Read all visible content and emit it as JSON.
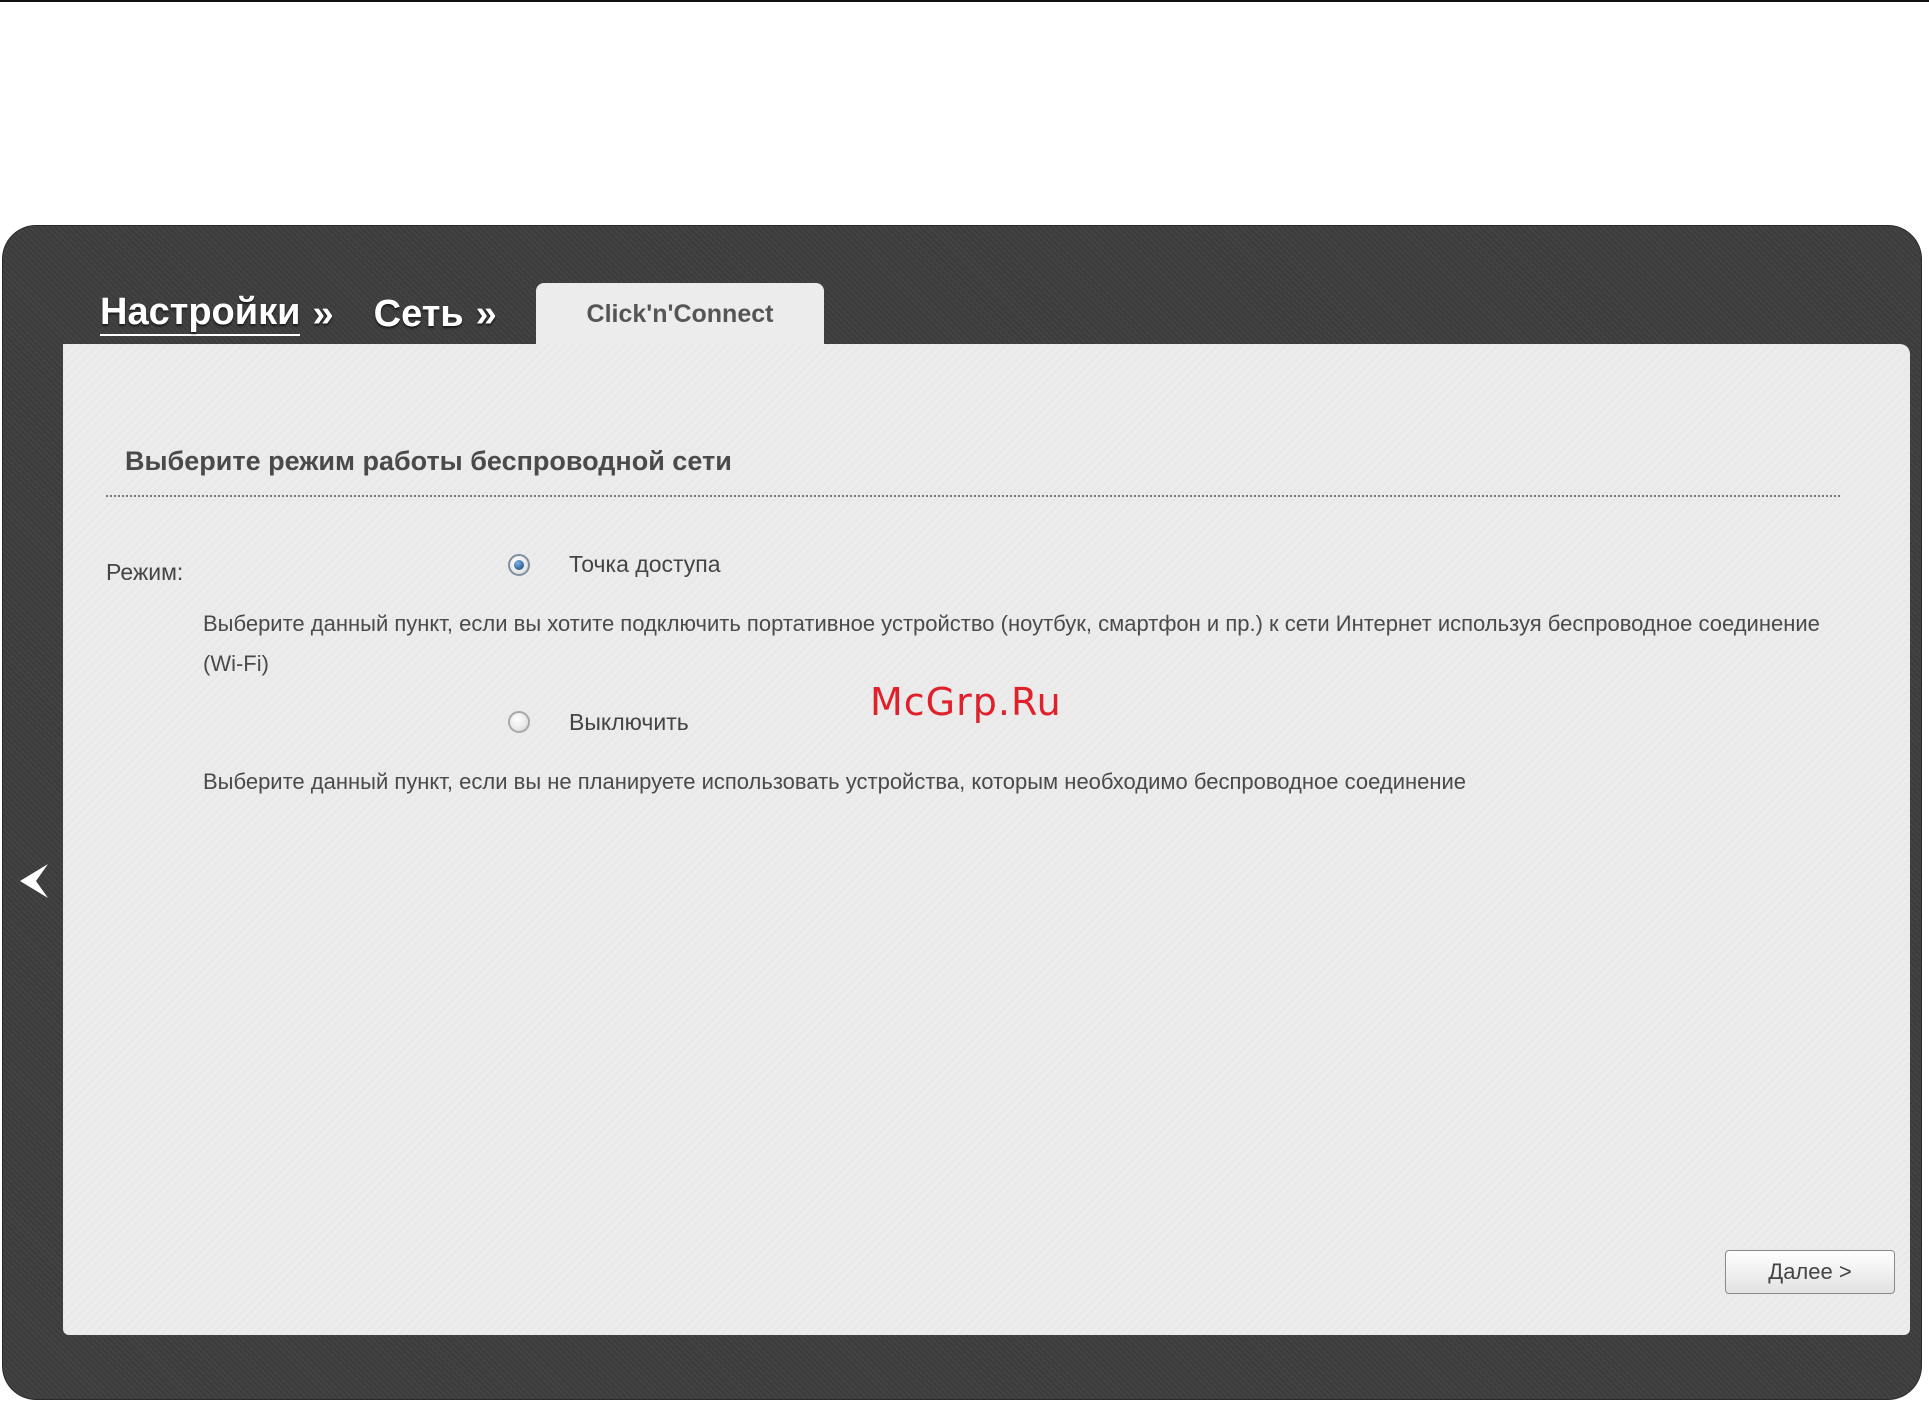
{
  "breadcrumb": {
    "items": [
      {
        "label": "Настройки",
        "sep": "»"
      },
      {
        "label": "Сеть",
        "sep": "»"
      }
    ]
  },
  "tab": {
    "label": "Click'n'Connect"
  },
  "section": {
    "title": "Выберите режим работы беспроводной сети"
  },
  "mode": {
    "label": "Режим:",
    "options": [
      {
        "label": "Точка доступа",
        "selected": true,
        "description": "Выберите данный пункт, если вы хотите подключить портативное устройство (ноутбук, смартфон и пр.) к сети Интернет используя беспроводное соединение (Wi-Fi)"
      },
      {
        "label": "Выключить",
        "selected": false,
        "description": "Выберите данный пункт, если вы не планируете использовать устройства, которым необходимо беспроводное соединение"
      }
    ]
  },
  "watermark": "McGrp.Ru",
  "nav": {
    "back_icon": "chevron-left-icon",
    "next_label": "Далее >"
  }
}
